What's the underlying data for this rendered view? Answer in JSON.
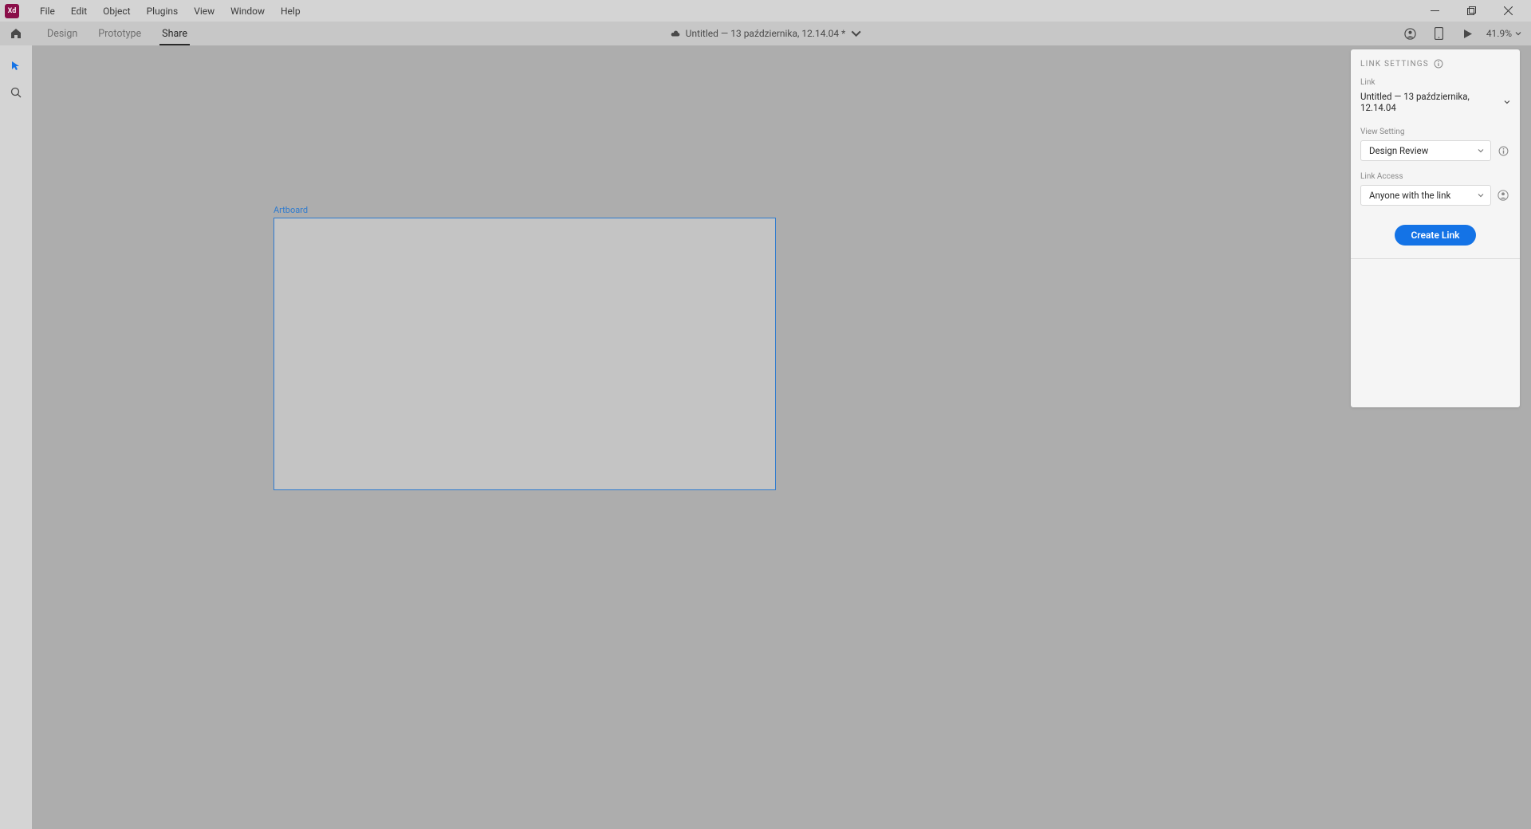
{
  "menu": {
    "items": [
      "File",
      "Edit",
      "Object",
      "Plugins",
      "View",
      "Window",
      "Help"
    ]
  },
  "app_logo": "Xd",
  "modes": {
    "items": [
      "Design",
      "Prototype",
      "Share"
    ],
    "active": "Share"
  },
  "doc_title": "Untitled — 13 października, 12.14.04 *",
  "zoom": "41.9%",
  "artboard_label": "Artboard",
  "panel": {
    "title": "LINK SETTINGS",
    "link_label": "Link",
    "link_value": "Untitled — 13 października, 12.14.04",
    "view_setting_label": "View Setting",
    "view_setting_value": "Design Review",
    "link_access_label": "Link Access",
    "link_access_value": "Anyone with the link",
    "create_button": "Create Link"
  }
}
